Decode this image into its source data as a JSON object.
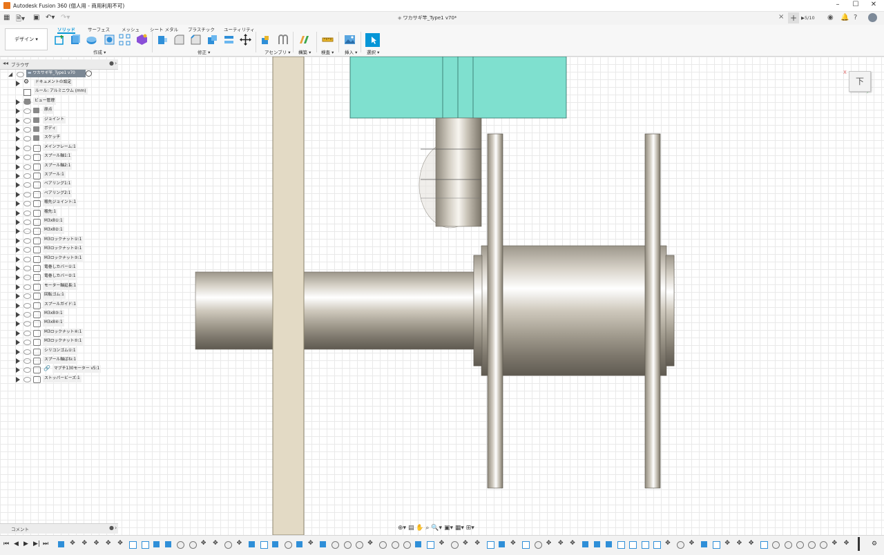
{
  "window": {
    "title": "Autodesk Fusion 360 (個人用 - 商用利用不可)",
    "minimize": "–",
    "maximize": "☐",
    "close": "✕"
  },
  "tabbar": {
    "doc_title": "ワカサギ竿_Type1 v70*",
    "jobs": "5/10",
    "close": "×",
    "add": "+"
  },
  "ribbon": {
    "workspace": "デザイン ▾",
    "tabs": [
      "ソリッド",
      "サーフェス",
      "メッシュ",
      "シート メタル",
      "プラスチック",
      "ユーティリティ"
    ],
    "active_tab": "ソリッド",
    "groups": [
      "作成 ▾",
      "修正 ▾",
      "アセンブリ ▾",
      "構築 ▾",
      "検査 ▾",
      "挿入 ▾",
      "選択 ▾"
    ],
    "accent": "#0696d7"
  },
  "browser": {
    "title": "ブラウザ",
    "root": "ワカサギ竿_Type1 v70",
    "items": [
      "ドキュメントの設定",
      "ルール: アルミニウム (mm)",
      "ビュー管理",
      "原点",
      "ジョイント",
      "ボディ",
      "スケッチ",
      "メインフレーム:1",
      "スプール軸1:1",
      "スプール軸2:1",
      "スプール:1",
      "ベアリング1:1",
      "ベアリング2:1",
      "穂先ジョイント:1",
      "穂先:1",
      "M3x8①:1",
      "M3x8②:1",
      "M3ロックナット①:1",
      "M3ロックナット②:1",
      "M3ロックナット③:1",
      "竜巻しカバー①:1",
      "竜巻しカバー②:1",
      "モーター軸延長:1",
      "回転ゴム:1",
      "スプールガイド:1",
      "M3x8③:1",
      "M3x8④:1",
      "M3ロックナット④:1",
      "M3ロックナット⑤:1",
      "シリコンゴム①:1",
      "スプール軸ばね:1",
      "マブチ130モーター v5:1",
      "ストッパービーズ:1"
    ]
  },
  "comments": {
    "title": "コメント"
  },
  "viewcube": {
    "face": "下"
  },
  "colors": {
    "teal": "#7fe0cf",
    "plate": "#e3dac5",
    "metal": "#b7b1a4"
  }
}
